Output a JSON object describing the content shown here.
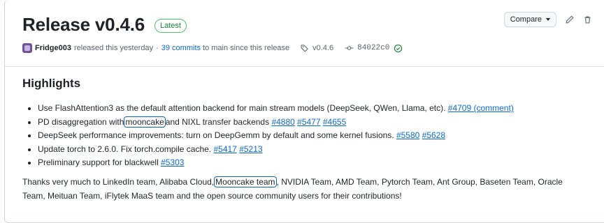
{
  "release": {
    "title": "Release v0.4.6",
    "badge": "Latest",
    "author": "Fridge003",
    "released_text": "released this yesterday",
    "commits_link": "39 commits",
    "commits_suffix": "to main since this release",
    "tag": "v0.4.6",
    "commit_sha": "84022c0"
  },
  "toolbar": {
    "compare_label": "Compare"
  },
  "highlights": {
    "heading": "Highlights",
    "items": [
      {
        "pre": "Use FlashAttention3 as the default attention backend for main stream models (DeepSeek, QWen, Llama, etc).",
        "links": [
          "#4709 (comment)"
        ]
      },
      {
        "pre": "PD disaggregation with",
        "boxed": "mooncake",
        "post": "and NIXL transfer backends",
        "links": [
          "#4880",
          "#5477",
          "#4655"
        ]
      },
      {
        "pre": "DeepSeek performance improvements: turn on DeepGemm by default and some kernel fusions.",
        "links": [
          "#5580",
          "#5628"
        ]
      },
      {
        "pre": "Update torch to 2.6.0. Fix torch.compile cache.",
        "links": [
          "#5417",
          "#5213"
        ]
      },
      {
        "pre": "Preliminary support for blackwell",
        "links": [
          "#5303"
        ]
      }
    ]
  },
  "thanks": {
    "pre": "Thanks very much to LinkedIn team, Alibaba Cloud,",
    "boxed": "Mooncake team",
    "post": ", NVIDIA Team, AMD Team, Pytorch Team, Ant Group, Baseten Team, Oracle Team, Meituan Team, iFlytek MaaS team and the open source community users for their contributions!"
  }
}
